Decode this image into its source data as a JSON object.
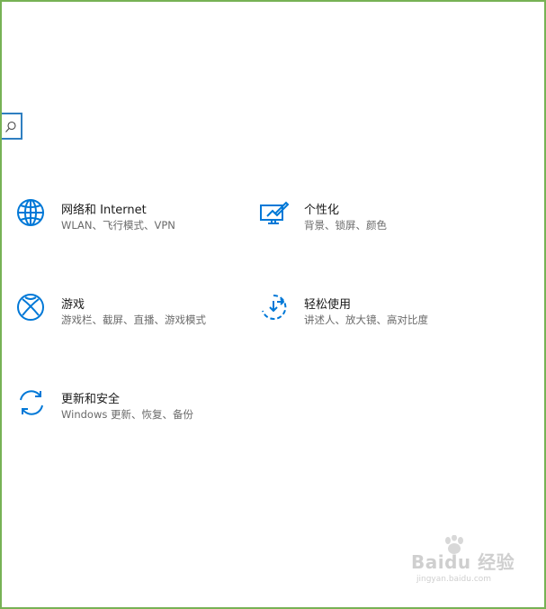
{
  "search": {
    "icon": "search-icon"
  },
  "tiles": [
    {
      "icon": "globe-icon",
      "title": "网络和 Internet",
      "desc": "WLAN、飞行模式、VPN"
    },
    {
      "icon": "personalization-icon",
      "title": "个性化",
      "desc": "背景、锁屏、颜色"
    },
    {
      "icon": "xbox-icon",
      "title": "游戏",
      "desc": "游戏栏、截屏、直播、游戏模式"
    },
    {
      "icon": "ease-of-access-icon",
      "title": "轻松使用",
      "desc": "讲述人、放大镜、高对比度"
    },
    {
      "icon": "update-sync-icon",
      "title": "更新和安全",
      "desc": "Windows 更新、恢复、备份"
    }
  ],
  "watermark": {
    "logo": "Baidu 经验",
    "url": "jingyan.baidu.com"
  },
  "colors": {
    "accent": "#0078d7",
    "border": "#77b255",
    "title": "#1a1a1a",
    "desc": "#6a6a6a"
  }
}
